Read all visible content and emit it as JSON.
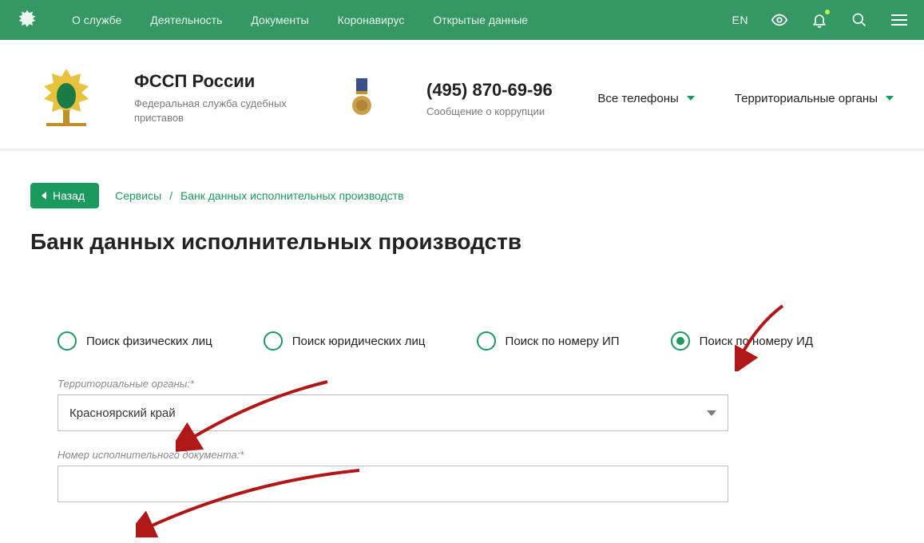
{
  "topnav": {
    "items": [
      "О службе",
      "Деятельность",
      "Документы",
      "Коронавирус",
      "Открытые данные"
    ],
    "lang": "EN"
  },
  "org": {
    "title": "ФССП России",
    "subtitle": "Федеральная служба судебных приставов"
  },
  "contact": {
    "phone": "(495) 870-69-96",
    "phone_sub": "Сообщение о коррупции",
    "all_phones": "Все телефоны",
    "territorial": "Территориальные органы"
  },
  "crumb": {
    "back": "Назад",
    "services": "Сервисы",
    "page": "Банк данных исполнительных производств"
  },
  "page_title": "Банк данных исполнительных производств",
  "radios": {
    "r0": "Поиск физических лиц",
    "r1": "Поиск юридических лиц",
    "r2": "Поиск по номеру ИП",
    "r3": "Поиск по номеру ИД",
    "selected_index": 3
  },
  "form": {
    "territory_label": "Территориальные органы:*",
    "territory_value": "Красноярский край",
    "docnum_label": "Номер исполнительного документа:*",
    "docnum_value": ""
  }
}
